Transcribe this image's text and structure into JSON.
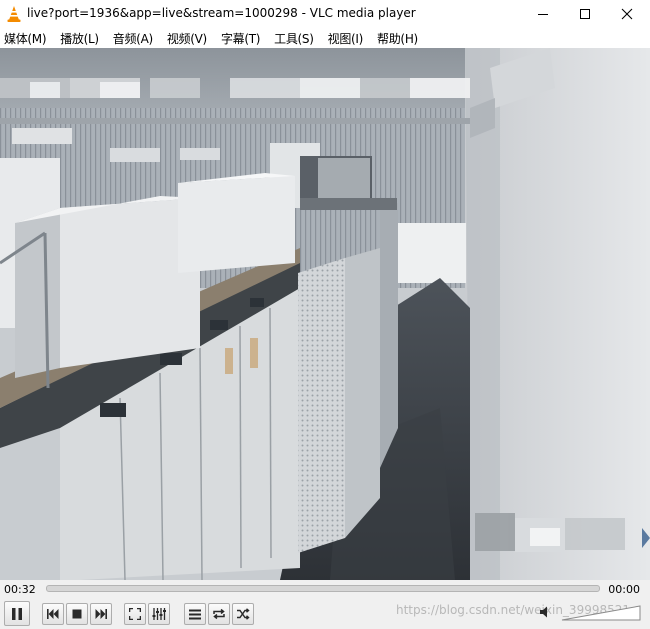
{
  "window": {
    "title": "live?port=1936&app=live&stream=1000298 - VLC media player",
    "controls": [
      "minimize",
      "maximize",
      "close"
    ]
  },
  "menu": {
    "items": [
      {
        "label": "媒体(M)"
      },
      {
        "label": "播放(L)"
      },
      {
        "label": "音频(A)"
      },
      {
        "label": "视频(V)"
      },
      {
        "label": "字幕(T)"
      },
      {
        "label": "工具(S)"
      },
      {
        "label": "视图(I)"
      },
      {
        "label": "帮助(H)"
      }
    ]
  },
  "playback": {
    "elapsed": "00:32",
    "total": "00:00",
    "progress": 0
  },
  "controls": {
    "buttons": [
      {
        "name": "pause-button",
        "icon": "pause-icon"
      },
      {
        "name": "previous-button",
        "icon": "skip-back-icon"
      },
      {
        "name": "stop-button",
        "icon": "stop-icon"
      },
      {
        "name": "next-button",
        "icon": "skip-forward-icon"
      },
      {
        "name": "fullscreen-button",
        "icon": "fullscreen-icon"
      },
      {
        "name": "extended-settings-button",
        "icon": "equalizer-icon"
      },
      {
        "name": "playlist-button",
        "icon": "playlist-icon"
      },
      {
        "name": "loop-button",
        "icon": "loop-icon"
      },
      {
        "name": "shuffle-button",
        "icon": "shuffle-icon"
      }
    ],
    "watermark": "https://blog.csdn.net/weixin_39998521",
    "volume_percent": 100
  },
  "colors": {
    "vlc_orange": "#f48b00",
    "titlebar_bg": "#ffffff",
    "controls_bg": "#f0f0f0"
  }
}
